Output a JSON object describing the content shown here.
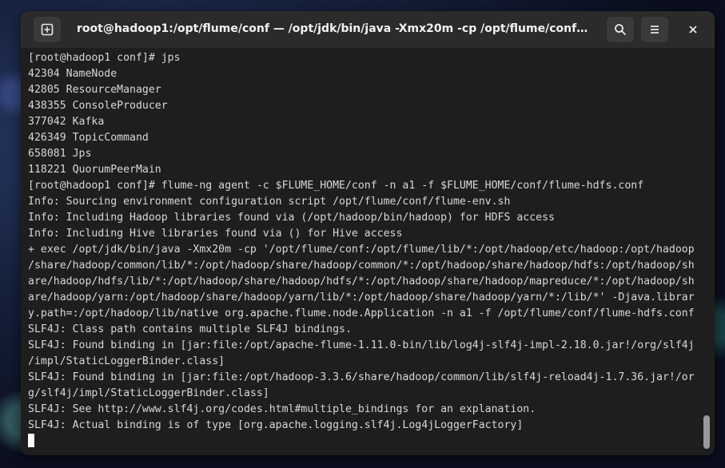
{
  "window": {
    "title": "root@hadoop1:/opt/flume/conf — /opt/jdk/bin/java -Xmx20m -cp /opt/flume/conf:/opt/flum…",
    "icons": {
      "new_tab": "new-tab-icon",
      "search": "search-icon",
      "menu": "hamburger-menu-icon",
      "close": "close-icon"
    }
  },
  "terminal": {
    "lines": [
      "[root@hadoop1 conf]# jps",
      "42304 NameNode",
      "42805 ResourceManager",
      "438355 ConsoleProducer",
      "377042 Kafka",
      "426349 TopicCommand",
      "658081 Jps",
      "118221 QuorumPeerMain",
      "[root@hadoop1 conf]# flume-ng agent -c $FLUME_HOME/conf -n a1 -f $FLUME_HOME/conf/flume-hdfs.conf",
      "Info: Sourcing environment configuration script /opt/flume/conf/flume-env.sh",
      "Info: Including Hadoop libraries found via (/opt/hadoop/bin/hadoop) for HDFS access",
      "Info: Including Hive libraries found via () for Hive access",
      "+ exec /opt/jdk/bin/java -Xmx20m -cp '/opt/flume/conf:/opt/flume/lib/*:/opt/hadoop/etc/hadoop:/opt/hadoop",
      "/share/hadoop/common/lib/*:/opt/hadoop/share/hadoop/common/*:/opt/hadoop/share/hadoop/hdfs:/opt/hadoop/sh",
      "are/hadoop/hdfs/lib/*:/opt/hadoop/share/hadoop/hdfs/*:/opt/hadoop/share/hadoop/mapreduce/*:/opt/hadoop/sh",
      "are/hadoop/yarn:/opt/hadoop/share/hadoop/yarn/lib/*:/opt/hadoop/share/hadoop/yarn/*:/lib/*' -Djava.librar",
      "y.path=:/opt/hadoop/lib/native org.apache.flume.node.Application -n a1 -f /opt/flume/conf/flume-hdfs.conf",
      "SLF4J: Class path contains multiple SLF4J bindings.",
      "SLF4J: Found binding in [jar:file:/opt/apache-flume-1.11.0-bin/lib/log4j-slf4j-impl-2.18.0.jar!/org/slf4j",
      "/impl/StaticLoggerBinder.class]",
      "SLF4J: Found binding in [jar:file:/opt/hadoop-3.3.6/share/hadoop/common/lib/slf4j-reload4j-1.7.36.jar!/or",
      "g/slf4j/impl/StaticLoggerBinder.class]",
      "SLF4J: See http://www.slf4j.org/codes.html#multiple_bindings for an explanation.",
      "SLF4J: Actual binding is of type [org.apache.logging.slf4j.Log4jLoggerFactory]",
      ""
    ]
  },
  "colors": {
    "terminal_bg": "#1e1e1e",
    "titlebar_bg": "#2b2b2b",
    "text": "#d8d8d8"
  }
}
